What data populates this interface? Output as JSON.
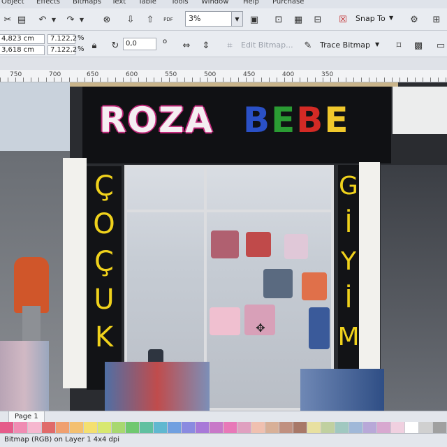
{
  "menu": [
    "Object",
    "Effects",
    "Bitmaps",
    "Text",
    "Table",
    "Tools",
    "Window",
    "Help",
    "Purchase"
  ],
  "toolbar": {
    "zoom_value": "3%",
    "pdf_label": "PDF",
    "snap_label": "Snap To"
  },
  "properties": {
    "width": "4,823 cm",
    "height": "3,618 cm",
    "scale_x": "7.122,2",
    "scale_y": "7.122,2",
    "percent": "%",
    "rotation": "0,0",
    "degree": "o",
    "edit_bitmap": "Edit Bitmap...",
    "trace_bitmap": "Trace Bitmap"
  },
  "ruler": {
    "labels": [
      "750",
      "700",
      "650",
      "600",
      "550",
      "500",
      "450",
      "400",
      "350"
    ]
  },
  "sign": {
    "roza": "ROZA",
    "bebe": [
      "B",
      "E",
      "B",
      "E"
    ],
    "left_vertical": [
      "Ç",
      "O",
      "Ç",
      "U",
      "K"
    ],
    "right_vertical": [
      "G",
      "İ",
      "Y",
      "İ",
      "M"
    ]
  },
  "page_tab": "Page 1",
  "palette": [
    "#e55b8a",
    "#f08cb3",
    "#f6b7cf",
    "#e06a6a",
    "#f0a070",
    "#f4c070",
    "#f4e070",
    "#d8e870",
    "#a8d870",
    "#70c870",
    "#60c0a0",
    "#60b8d0",
    "#70a0e0",
    "#8a8ae0",
    "#a878d8",
    "#c878c8",
    "#e878b8",
    "#e0a0c0",
    "#f0c0b0",
    "#d8b098",
    "#c09080",
    "#a87868",
    "#e8e0a0",
    "#c0d0a0",
    "#a0c8c0",
    "#a0b8d8",
    "#b8a8d8",
    "#d8a8d0",
    "#f0d0e0",
    "#ffffff",
    "#d0d0d0",
    "#a0a0a0"
  ],
  "status": "Bitmap (RGB) on Layer 1 4x4 dpi"
}
